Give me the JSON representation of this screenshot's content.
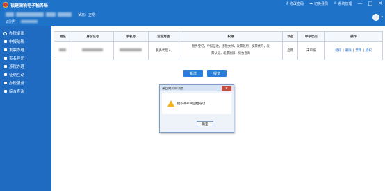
{
  "app": {
    "title": "福建国税电子税务局"
  },
  "top_links": [
    {
      "icon": "key-icon",
      "label": "修改密码"
    },
    {
      "icon": "cloud-icon",
      "label": "切换县局"
    },
    {
      "icon": "user-icon",
      "label": "系统管理"
    }
  ],
  "window_controls": [
    "—",
    "□",
    "✕"
  ],
  "taxpayer": {
    "status_label": "状态：正常",
    "id_label": "识别号："
  },
  "sidebar": {
    "items": [
      {
        "label": "办税桌面"
      },
      {
        "label": "申报纳税"
      },
      {
        "label": "发票办理"
      },
      {
        "label": "实名登记"
      },
      {
        "label": "涉税办理"
      },
      {
        "label": "征纳互动"
      },
      {
        "label": "办税服务"
      },
      {
        "label": "综合查询"
      }
    ]
  },
  "table": {
    "headers": [
      "姓名",
      "身份证号",
      "手机号",
      "企业角色",
      "权限",
      "状态",
      "审核状态",
      "操作"
    ],
    "row": {
      "role": "税务代理人",
      "permissions_line1": "税务登记，申报征收，涉税文书，发票领用，发票代开，发",
      "permissions_line2": "票认证，发票验旧，综合查询",
      "status": "启用",
      "review": "未审核",
      "ops": [
        "授权",
        "删除",
        "禁用",
        "授权"
      ]
    }
  },
  "buttons": {
    "add": "新增",
    "submit": "提交"
  },
  "dialog": {
    "title": "来自网页的消息",
    "close": "✕",
    "message": "授权书PDF回档成功！",
    "ok": "确定"
  }
}
